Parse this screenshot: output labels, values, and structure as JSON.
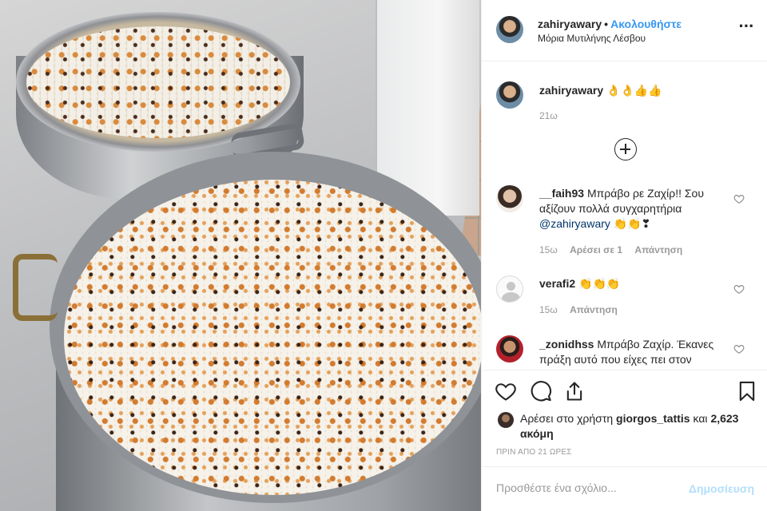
{
  "header": {
    "username": "zahiryawary",
    "dot": "•",
    "follow_label": "Ακολουθήστε",
    "location": "Μόρια Μυτιλήνης Λέσβου",
    "more_icon": "more-options-icon"
  },
  "caption": {
    "username": "zahiryawary",
    "text": "👌👌👍👍",
    "time": "21ω"
  },
  "load_more_icon": "plus-circle-icon",
  "comments": [
    {
      "username": "__faih93",
      "text": "Μπράβο ρε Ζαχίρ!! Σου αξίζουν πολλά συγχαρητήρια",
      "mention": "@zahiryawary",
      "suffix": "👏👏❣",
      "time": "15ω",
      "likes_label": "Αρέσει σε 1",
      "reply_label": "Απάντηση"
    },
    {
      "username": "verafi2",
      "text": "👏👏👏",
      "time": "15ω",
      "reply_label": "Απάντηση"
    },
    {
      "username": "_zonidhss",
      "text": "Μπράβο Ζαχίρ. Έκανες πράξη αυτό που είχες πει στον"
    }
  ],
  "likes": {
    "prefix": "Αρέσει στο χρήστη",
    "user": "giorgos_tattis",
    "connector": "και",
    "count": "2,623 ακόμη"
  },
  "posted_time": "ΠΡΙΝ ΑΠΟ 21 ΩΡΕΣ",
  "add_comment": {
    "placeholder": "Προσθέστε ένα σχόλιο...",
    "post_label": "Δημοσίευση"
  },
  "colors": {
    "accent": "#3897f0",
    "post_disabled": "#b2dffc",
    "muted": "#999999",
    "text": "#262626"
  }
}
